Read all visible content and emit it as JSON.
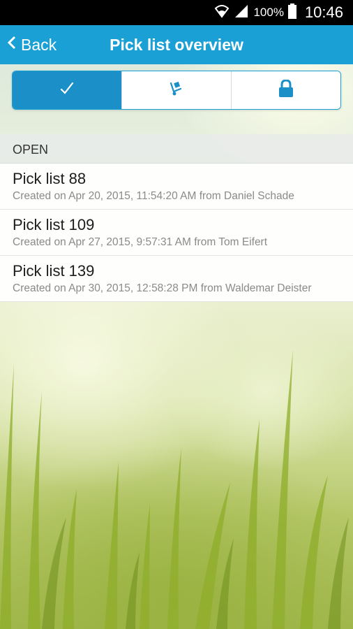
{
  "status_bar": {
    "battery": "100%",
    "time": "10:46",
    "icons": [
      "wifi-icon",
      "signal-icon",
      "battery-icon"
    ]
  },
  "app_bar": {
    "back_label": "Back",
    "title": "Pick list overview",
    "color": "#1aa0d4"
  },
  "tabs": [
    {
      "icon": "checkmark-icon",
      "active": true
    },
    {
      "icon": "hand-truck-icon",
      "active": false
    },
    {
      "icon": "lock-icon",
      "active": false
    }
  ],
  "section": {
    "header": "OPEN"
  },
  "pick_lists": [
    {
      "title": "Pick list 88",
      "subtitle": "Created on Apr 20, 2015, 11:54:20 AM from Daniel Schade"
    },
    {
      "title": "Pick list 109",
      "subtitle": "Created on Apr 27, 2015, 9:57:31 AM from Tom Eifert"
    },
    {
      "title": "Pick list 139",
      "subtitle": "Created on Apr 30, 2015, 12:58:28 PM from Waldemar Deister"
    }
  ]
}
